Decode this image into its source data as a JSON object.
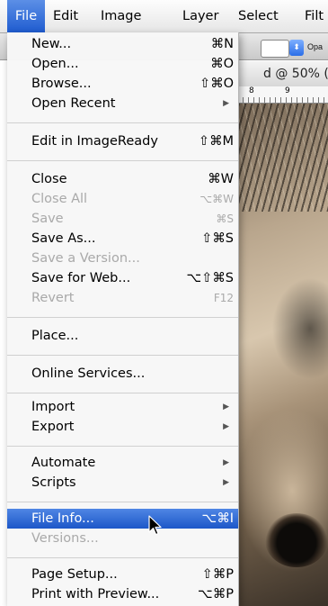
{
  "menubar": {
    "items": [
      {
        "label": "File"
      },
      {
        "label": "Edit"
      },
      {
        "label": "Image"
      },
      {
        "label": "Layer"
      },
      {
        "label": "Select"
      },
      {
        "label": "Filt"
      }
    ]
  },
  "background": {
    "opacity_label": "Opa",
    "window_title": "d @ 50% (",
    "ruler_numbers": [
      "8",
      "9"
    ]
  },
  "file_menu": {
    "items": [
      {
        "label": "New...",
        "shortcut": "⌘N",
        "enabled": true
      },
      {
        "label": "Open...",
        "shortcut": "⌘O",
        "enabled": true
      },
      {
        "label": "Browse...",
        "shortcut": "⇧⌘O",
        "enabled": true
      },
      {
        "label": "Open Recent",
        "submenu": true,
        "enabled": true
      },
      {
        "label": "Edit in ImageReady",
        "shortcut": "⇧⌘M",
        "enabled": true
      },
      {
        "label": "Close",
        "shortcut": "⌘W",
        "enabled": true
      },
      {
        "label": "Close All",
        "shortcut": "⌥⌘W",
        "enabled": false
      },
      {
        "label": "Save",
        "shortcut": "⌘S",
        "enabled": false
      },
      {
        "label": "Save As...",
        "shortcut": "⇧⌘S",
        "enabled": true
      },
      {
        "label": "Save a Version...",
        "enabled": false
      },
      {
        "label": "Save for Web...",
        "shortcut": "⌥⇧⌘S",
        "enabled": true
      },
      {
        "label": "Revert",
        "shortcut": "F12",
        "enabled": false
      },
      {
        "label": "Place...",
        "enabled": true
      },
      {
        "label": "Online Services...",
        "enabled": true
      },
      {
        "label": "Import",
        "submenu": true,
        "enabled": true
      },
      {
        "label": "Export",
        "submenu": true,
        "enabled": true
      },
      {
        "label": "Automate",
        "submenu": true,
        "enabled": true
      },
      {
        "label": "Scripts",
        "submenu": true,
        "enabled": true
      },
      {
        "label": "File Info...",
        "shortcut": "⌥⌘I",
        "enabled": true,
        "highlighted": true
      },
      {
        "label": "Versions...",
        "enabled": false
      },
      {
        "label": "Page Setup...",
        "shortcut": "⇧⌘P",
        "enabled": true
      },
      {
        "label": "Print with Preview...",
        "shortcut": "⌥⌘P",
        "enabled": true
      }
    ]
  }
}
